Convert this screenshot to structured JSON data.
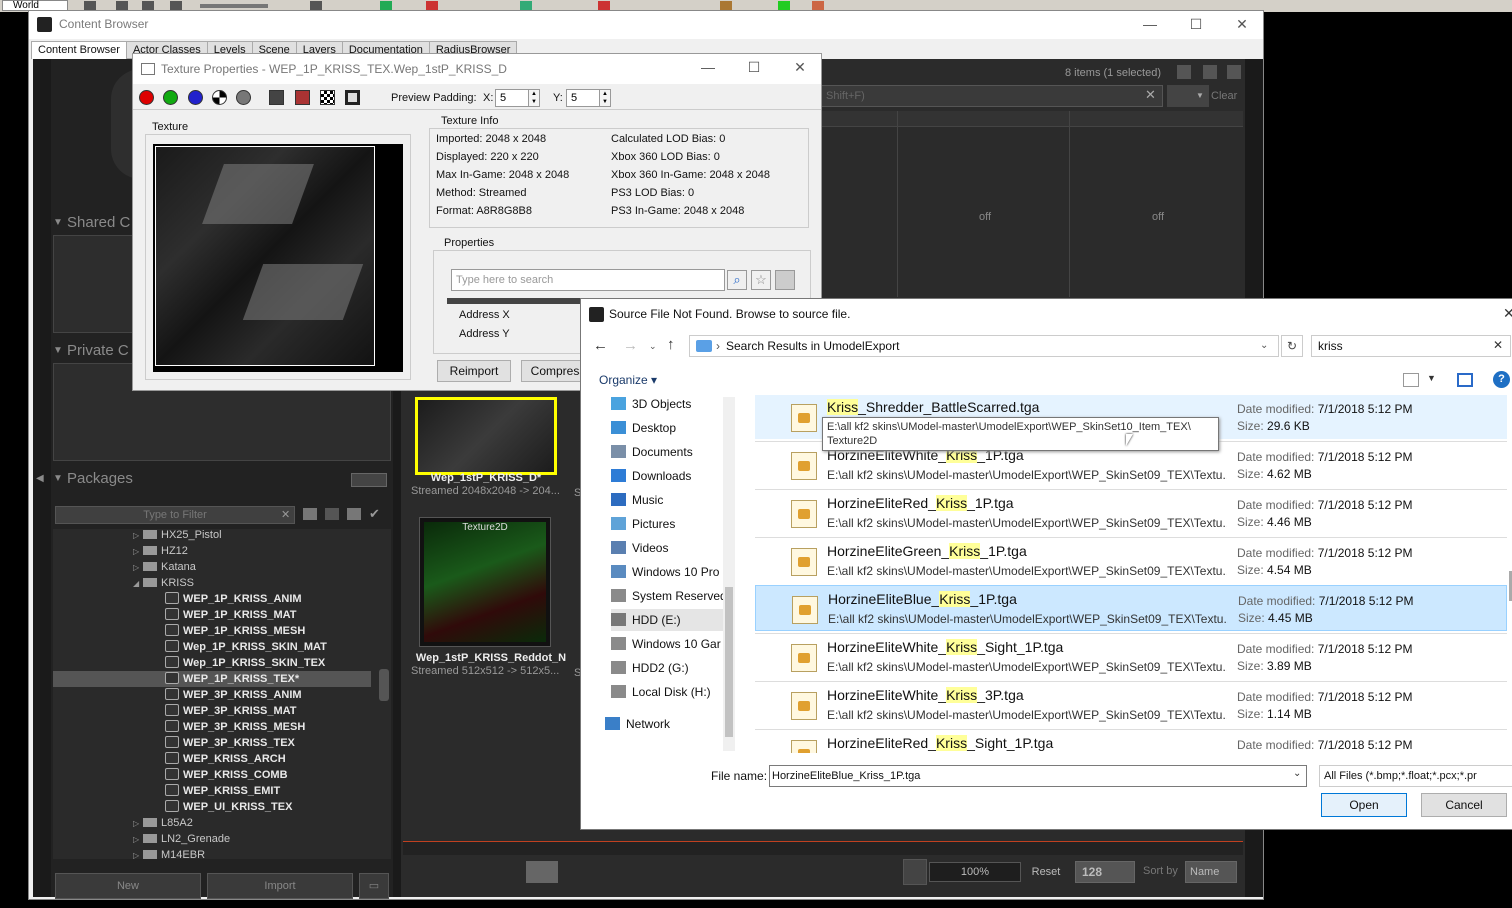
{
  "topbar": {
    "world": "World"
  },
  "content_browser": {
    "title": "Content Browser",
    "tabs": [
      "Content Browser",
      "Actor Classes",
      "Levels",
      "Scene",
      "Layers",
      "Documentation",
      "RadiusBrowser"
    ],
    "items_count": "8 items (1 selected)",
    "search_fragment": "Shift+F)",
    "clear": "Clear",
    "col_off_1": "off",
    "col_off_2": "off",
    "sections": {
      "shared": "Shared C",
      "private": "Private C",
      "packages": "Packages"
    },
    "filter_placeholder": "Type to Filter",
    "tree": [
      {
        "label": "HX25_Pistol",
        "type": "folder"
      },
      {
        "label": "HZ12",
        "type": "folder"
      },
      {
        "label": "Katana",
        "type": "folder"
      },
      {
        "label": "KRISS",
        "type": "folder-open"
      },
      {
        "label": "WEP_1P_KRISS_ANIM",
        "type": "pkg"
      },
      {
        "label": "WEP_1P_KRISS_MAT",
        "type": "pkg"
      },
      {
        "label": "WEP_1P_KRISS_MESH",
        "type": "pkg"
      },
      {
        "label": "Wep_1P_KRISS_SKIN_MAT",
        "type": "pkg"
      },
      {
        "label": "Wep_1P_KRISS_SKIN_TEX",
        "type": "pkg"
      },
      {
        "label": "WEP_1P_KRISS_TEX*",
        "type": "pkg",
        "selected": true
      },
      {
        "label": "WEP_3P_KRISS_ANIM",
        "type": "pkg"
      },
      {
        "label": "WEP_3P_KRISS_MAT",
        "type": "pkg"
      },
      {
        "label": "WEP_3P_KRISS_MESH",
        "type": "pkg"
      },
      {
        "label": "WEP_3P_KRISS_TEX",
        "type": "pkg"
      },
      {
        "label": "WEP_KRISS_ARCH",
        "type": "pkg"
      },
      {
        "label": "WEP_KRISS_COMB",
        "type": "pkg"
      },
      {
        "label": "WEP_KRISS_EMIT",
        "type": "pkg"
      },
      {
        "label": "WEP_UI_KRISS_TEX",
        "type": "pkg"
      },
      {
        "label": "L85A2",
        "type": "folder"
      },
      {
        "label": "LN2_Grenade",
        "type": "folder"
      },
      {
        "label": "M14EBR",
        "type": "folder"
      }
    ],
    "new_btn": "New",
    "import_btn": "Import",
    "asset1": {
      "name": "Wep_1stP_KRISS_D*",
      "info": "Streamed 2048x2048 -> 204..."
    },
    "asset2": {
      "type": "Texture2D",
      "name": "Wep_1stP_KRISS_Reddot_N",
      "info": "Streamed 512x512 -> 512x5..."
    },
    "zoom": "100%",
    "reset": "Reset",
    "size": "128",
    "sort_label": "Sort by",
    "sort_value": "Name"
  },
  "texture_props": {
    "title": "Texture Properties - WEP_1P_KRISS_TEX.Wep_1stP_KRISS_D",
    "preview_padding": "Preview Padding:",
    "x_label": "X:",
    "x_val": "5",
    "y_label": "Y:",
    "y_val": "5",
    "texture_label": "Texture",
    "info_label": "Texture Info",
    "info_left": [
      "Imported: 2048 x 2048",
      "Displayed: 220 x 220",
      "Max In-Game: 2048 x 2048",
      "Method: Streamed",
      "Format: A8R8G8B8"
    ],
    "info_right": [
      "Calculated LOD Bias: 0",
      "Xbox 360 LOD Bias: 0",
      "Xbox 360 In-Game: 2048 x 2048",
      "PS3 LOD Bias: 0",
      "PS3 In-Game: 2048 x 2048"
    ],
    "properties_label": "Properties",
    "search_placeholder": "Type here to search",
    "prop_rows": [
      "Address X",
      "Address Y"
    ],
    "reimport": "Reimport",
    "compress": "Compress"
  },
  "dialog": {
    "title": "Source File Not Found.  Browse to source file.",
    "breadcrumb": "Search Results in UmodelExport",
    "search_value": "kriss",
    "organize": "Organize",
    "nav": [
      "3D Objects",
      "Desktop",
      "Documents",
      "Downloads",
      "Music",
      "Pictures",
      "Videos",
      "Windows 10 Pro",
      "System Reserved",
      "HDD (E:)",
      "Windows 10 Gar",
      "HDD2 (G:)",
      "Local Disk (H:)",
      "Network"
    ],
    "files": [
      {
        "pre": "",
        "hl": "Kriss",
        "post": "_Shredder_BattleScarred.tga",
        "path": "",
        "date": "7/1/2018 5:12 PM",
        "size": "29.6 KB"
      },
      {
        "pre": "HorzineEliteWhite_",
        "hl": "Kriss",
        "post": "_1P.tga",
        "path": "E:\\all kf2 skins\\UModel-master\\UmodelExport\\WEP_SkinSet09_TEX\\Textu...",
        "date": "7/1/2018 5:12 PM",
        "size": "4.62 MB"
      },
      {
        "pre": "HorzineEliteRed_",
        "hl": "Kriss",
        "post": "_1P.tga",
        "path": "E:\\all kf2 skins\\UModel-master\\UmodelExport\\WEP_SkinSet09_TEX\\Textu...",
        "date": "7/1/2018 5:12 PM",
        "size": "4.46 MB"
      },
      {
        "pre": "HorzineEliteGreen_",
        "hl": "Kriss",
        "post": "_1P.tga",
        "path": "E:\\all kf2 skins\\UModel-master\\UmodelExport\\WEP_SkinSet09_TEX\\Textu...",
        "date": "7/1/2018 5:12 PM",
        "size": "4.54 MB"
      },
      {
        "pre": "HorzineEliteBlue_",
        "hl": "Kriss",
        "post": "_1P.tga",
        "path": "E:\\all kf2 skins\\UModel-master\\UmodelExport\\WEP_SkinSet09_TEX\\Textu...",
        "date": "7/1/2018 5:12 PM",
        "size": "4.45 MB"
      },
      {
        "pre": "HorzineEliteWhite_",
        "hl": "Kriss",
        "post": "_Sight_1P.tga",
        "path": "E:\\all kf2 skins\\UModel-master\\UmodelExport\\WEP_SkinSet09_TEX\\Textu...",
        "date": "7/1/2018 5:12 PM",
        "size": "3.89 MB"
      },
      {
        "pre": "HorzineEliteWhite_",
        "hl": "Kriss",
        "post": "_3P.tga",
        "path": "E:\\all kf2 skins\\UModel-master\\UmodelExport\\WEP_SkinSet09_TEX\\Textu...",
        "date": "7/1/2018 5:12 PM",
        "size": "1.14 MB"
      },
      {
        "pre": "HorzineEliteRed_",
        "hl": "Kriss",
        "post": "_Sight_1P.tga",
        "path": "",
        "date": "7/1/2018 5:12 PM",
        "size": ""
      }
    ],
    "date_label": "Date modified:",
    "size_label": "Size:",
    "tooltip_line1": "E:\\all kf2 skins\\UModel-master\\UmodelExport\\WEP_SkinSet10_Item_TEX\\",
    "tooltip_line2": "Texture2D",
    "filename_label": "File name:",
    "filename_value": "HorzineEliteBlue_Kriss_1P.tga",
    "filetype": "All Files (*.bmp;*.float;*.pcx;*.pr",
    "open": "Open",
    "cancel": "Cancel"
  }
}
